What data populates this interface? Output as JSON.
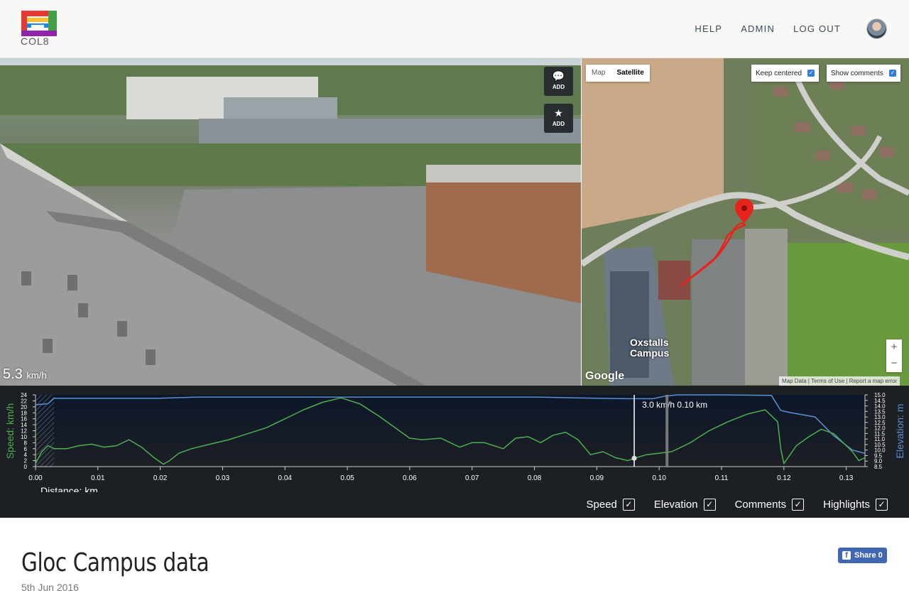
{
  "header": {
    "logo_text": "COL8",
    "nav": [
      "HELP",
      "ADMIN",
      "LOG OUT"
    ]
  },
  "video": {
    "comment_button": {
      "icon": "speech-bubble-icon",
      "label": "ADD"
    },
    "highlight_button": {
      "icon": "star-icon",
      "label": "ADD"
    },
    "speed_value": "5.3",
    "speed_unit": "km/h"
  },
  "map": {
    "type_buttons": [
      "Map",
      "Satellite"
    ],
    "active_type": "Satellite",
    "keep_centered": "Keep centered",
    "show_comments": "Show comments",
    "zoom_in": "+",
    "zoom_out": "−",
    "google": "Google",
    "attribution": "Map Data | Terms of Use | Report a map error",
    "label": "Oxstalls Campus",
    "colors": {
      "route": "#e8231b",
      "road": "#cfd0cc"
    }
  },
  "chart_data": {
    "type": "line",
    "xlabel": "Distance: km",
    "ylabel_left": "Speed: km/h",
    "ylabel_right": "Elevation: m",
    "xlim": [
      0,
      0.133
    ],
    "ylim_left": [
      0,
      24
    ],
    "ylim_right": [
      8.5,
      15.0
    ],
    "x_ticks": [
      "0.00",
      "0.01",
      "0.02",
      "0.03",
      "0.04",
      "0.05",
      "0.06",
      "0.07",
      "0.08",
      "0.09",
      "0.10",
      "0.11",
      "0.12",
      "0.13"
    ],
    "left_ticks": [
      "0",
      "2",
      "4",
      "6",
      "8",
      "10",
      "12",
      "14",
      "16",
      "18",
      "20",
      "22",
      "24"
    ],
    "right_ticks": [
      "8.5",
      "9.0",
      "9.5",
      "10.0",
      "10.5",
      "11.0",
      "11.5",
      "12.0",
      "12.5",
      "13.0",
      "13.5",
      "14.0",
      "14.5",
      "15.0"
    ],
    "cursor_label": "3.0 km/h 0.10 km",
    "series": [
      {
        "name": "Speed",
        "color": "#4caf50",
        "x": [
          0,
          0.001,
          0.002,
          0.003,
          0.005,
          0.007,
          0.009,
          0.011,
          0.013,
          0.015,
          0.017,
          0.019,
          0.0205,
          0.0215,
          0.023,
          0.025,
          0.028,
          0.031,
          0.034,
          0.037,
          0.04,
          0.043,
          0.046,
          0.049,
          0.052,
          0.055,
          0.058,
          0.06,
          0.062,
          0.065,
          0.068,
          0.07,
          0.072,
          0.075,
          0.077,
          0.079,
          0.081,
          0.083,
          0.085,
          0.087,
          0.089,
          0.091,
          0.093,
          0.095,
          0.096,
          0.098,
          0.1,
          0.102,
          0.105,
          0.108,
          0.111,
          0.114,
          0.117,
          0.119,
          0.1195,
          0.12,
          0.122,
          0.124,
          0.126,
          0.128,
          0.1295,
          0.131,
          0.132,
          0.133
        ],
        "values": [
          1,
          5,
          7,
          6,
          6,
          7,
          7.5,
          6.5,
          7,
          9,
          6.5,
          3,
          0.8,
          2,
          4.5,
          6,
          7.5,
          9,
          11,
          13,
          16,
          19,
          21.5,
          23,
          21,
          17,
          12.5,
          9.5,
          9,
          9.5,
          6.5,
          8,
          8,
          6,
          9.5,
          10,
          8,
          10.5,
          11.5,
          9,
          4,
          5,
          3,
          2,
          2.8,
          4,
          4.5,
          5,
          8,
          12,
          15,
          17.5,
          19,
          15,
          6,
          1,
          7,
          10,
          12.5,
          11,
          8,
          5,
          2,
          3
        ]
      },
      {
        "name": "Elevation",
        "color": "#5a8fd0",
        "x": [
          0,
          0.002,
          0.003,
          0.01,
          0.02,
          0.026,
          0.035,
          0.05,
          0.06,
          0.08,
          0.09,
          0.095,
          0.099,
          0.101,
          0.103,
          0.11,
          0.118,
          0.1195,
          0.121,
          0.125,
          0.128,
          0.131,
          0.133
        ],
        "values": [
          14.1,
          14.2,
          14.7,
          14.7,
          14.7,
          14.8,
          14.8,
          14.8,
          14.8,
          14.8,
          14.7,
          14.65,
          14.65,
          14.9,
          15.0,
          15.0,
          14.95,
          13.6,
          13.4,
          13.0,
          11.3,
          10.0,
          9.7
        ]
      }
    ]
  },
  "toggles": [
    {
      "label": "Speed",
      "checked": true
    },
    {
      "label": "Elevation",
      "checked": true
    },
    {
      "label": "Comments",
      "checked": true
    },
    {
      "label": "Highlights",
      "checked": true
    }
  ],
  "page": {
    "title": "Gloc Campus data",
    "date": "5th Jun 2016",
    "share_label": "Share 0"
  }
}
